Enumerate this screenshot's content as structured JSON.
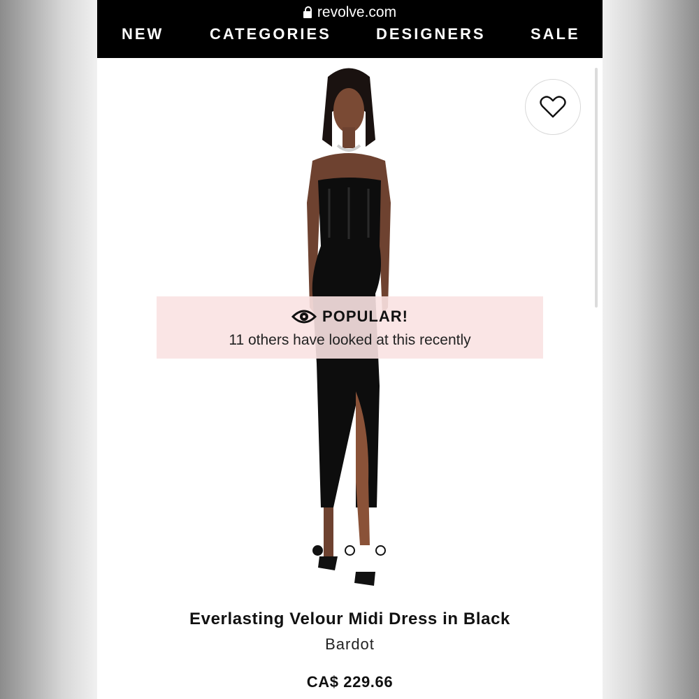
{
  "browser": {
    "url": "revolve.com"
  },
  "nav": {
    "items": [
      "NEW",
      "CATEGORIES",
      "DESIGNERS",
      "SALE"
    ]
  },
  "popular": {
    "title": "POPULAR!",
    "message": "11 others have looked at this recently"
  },
  "carousel": {
    "total": 3,
    "active_index": 0
  },
  "product": {
    "name": "Everlasting Velour Midi Dress in Black",
    "brand": "Bardot",
    "price": "CA$ 229.66"
  },
  "icons": [
    "lock-icon",
    "heart-icon",
    "eye-icon"
  ],
  "colors": {
    "topbar": "#000000",
    "popular_banner": "#fae2e2",
    "text": "#111111"
  }
}
